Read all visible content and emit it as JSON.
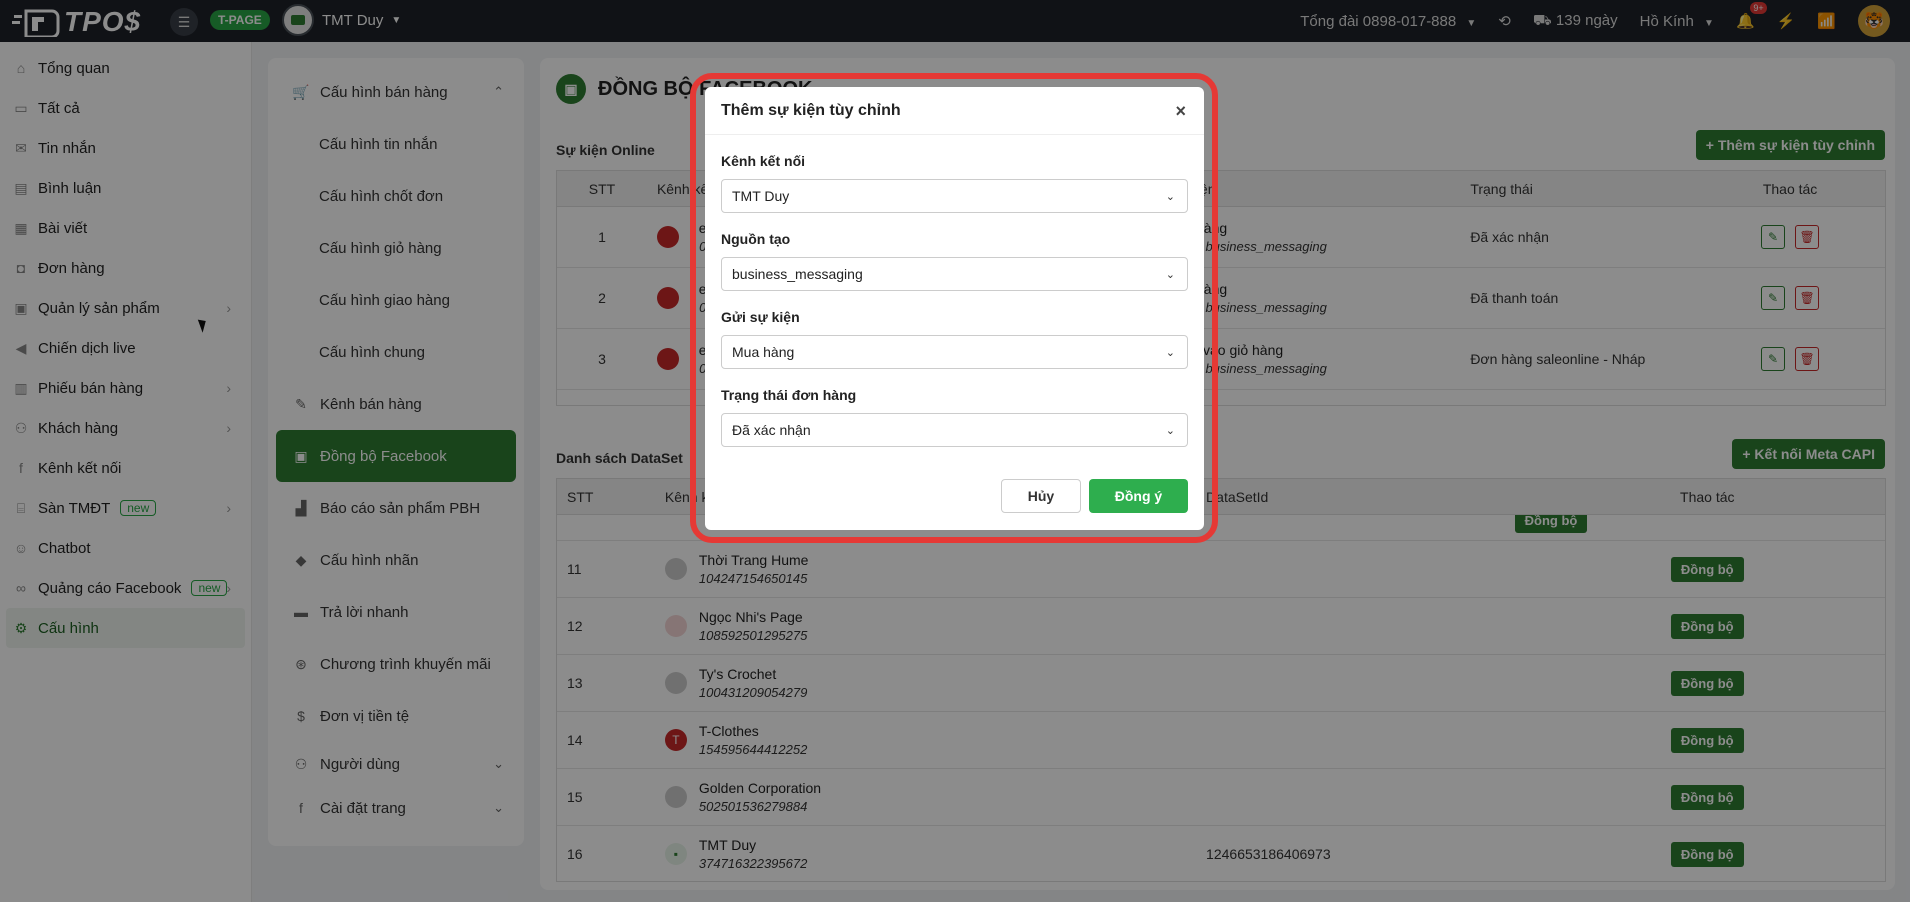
{
  "topbar": {
    "logo_text": "TPO$",
    "tpage_badge": "T-PAGE",
    "current_page": "TMT Duy",
    "hotline_label": "Tổng đài",
    "hotline_number": "0898-017-888",
    "days_left": "139 ngày",
    "user_name": "Hồ Kính",
    "notif_count": "9+"
  },
  "sidebar": {
    "items": [
      {
        "label": "Tổng quan",
        "icon": "home-icon"
      },
      {
        "label": "Tất cả",
        "icon": "inbox-icon"
      },
      {
        "label": "Tin nhắn",
        "icon": "mail-icon"
      },
      {
        "label": "Bình luận",
        "icon": "comment-icon"
      },
      {
        "label": "Bài viết",
        "icon": "post-icon"
      },
      {
        "label": "Đơn hàng",
        "icon": "bag-icon"
      },
      {
        "label": "Quản lý sản phẩm",
        "icon": "product-icon"
      },
      {
        "label": "Chiến dịch live",
        "icon": "megaphone-icon"
      },
      {
        "label": "Phiếu bán hàng",
        "icon": "receipt-icon"
      },
      {
        "label": "Khách hàng",
        "icon": "users-icon"
      },
      {
        "label": "Kênh kết nối",
        "icon": "facebook-icon"
      },
      {
        "label": "Sàn TMĐT",
        "icon": "store-icon",
        "badge": "new"
      },
      {
        "label": "Chatbot",
        "icon": "bot-icon"
      },
      {
        "label": "Quảng cáo Facebook",
        "icon": "meta-icon",
        "badge": "new"
      },
      {
        "label": "Cấu hình",
        "icon": "gear-icon"
      }
    ]
  },
  "settings_menu": {
    "group_title": "Cấu hình bán hàng",
    "sub_items": [
      "Cấu hình tin nhắn",
      "Cấu hình chốt đơn",
      "Cấu hình giỏ hàng",
      "Cấu hình giao hàng",
      "Cấu hình chung"
    ],
    "items": [
      "Kênh bán hàng",
      "Đồng bộ Facebook",
      "Báo cáo sản phẩm PBH",
      "Cấu hình nhãn",
      "Trả lời nhanh",
      "Chương trình khuyến mãi",
      "Đơn vị tiền tệ",
      "Người dùng",
      "Cài đặt trang"
    ]
  },
  "content": {
    "title": "ĐỒNG BỘ FACEBOOK",
    "events_label": "Sự kiện Online",
    "add_event_button": "+ Thêm sự kiện tùy chỉnh",
    "events_table": {
      "headers": [
        "STT",
        "Kênh kế",
        "ự kiện",
        "Trạng thái",
        "Thao tác"
      ],
      "rows": [
        {
          "stt": "1",
          "name": "I e's",
          "id": "• 06",
          "event": "ua hàng",
          "source": "uồn: business_messaging",
          "status": "Đã xác nhận"
        },
        {
          "stt": "2",
          "name": "I e's",
          "id": "• 06",
          "event": "ua hàng",
          "source": "uồn: business_messaging",
          "status": "Đã thanh toán"
        },
        {
          "stt": "3",
          "name": "I e's",
          "id": "• 06",
          "event": "iêm vào giỏ hàng",
          "source": "uồn: business_messaging",
          "status": "Đơn hàng saleonline - Nháp"
        }
      ]
    },
    "dataset_label": "Danh sách DataSet",
    "connect_capi_button": "+ Kết nối Meta CAPI",
    "dataset_table": {
      "headers": [
        "STT",
        "Kênh k",
        "DataSetId",
        "Thao tác"
      ],
      "partial_row_button": "Đồng bộ",
      "rows": [
        {
          "stt": "11",
          "name": "Thời Trang Hume",
          "id": "104247154650145",
          "dataset": "",
          "action": "Đồng bộ"
        },
        {
          "stt": "12",
          "name": "Ngọc Nhi's Page",
          "id": "108592501295275",
          "dataset": "",
          "action": "Đồng bộ"
        },
        {
          "stt": "13",
          "name": "Ty's Crochet",
          "id": "100431209054279",
          "dataset": "",
          "action": "Đồng bộ"
        },
        {
          "stt": "14",
          "name": "T-Clothes",
          "id": "154595644412252",
          "dataset": "",
          "action": "Đồng bộ",
          "avatar_letter": "T"
        },
        {
          "stt": "15",
          "name": "Golden Corporation",
          "id": "502501536279884",
          "dataset": "",
          "action": "Đồng bộ"
        },
        {
          "stt": "16",
          "name": "TMT Duy",
          "id": "374716322395672",
          "dataset": "1246653186406973",
          "action": "Đồng bộ"
        }
      ]
    }
  },
  "modal": {
    "title": "Thêm sự kiện tùy chỉnh",
    "fields": [
      {
        "label": "Kênh kết nối",
        "value": "TMT Duy"
      },
      {
        "label": "Nguồn tạo",
        "value": "business_messaging"
      },
      {
        "label": "Gửi sự kiện",
        "value": "Mua hàng"
      },
      {
        "label": "Trạng thái đơn hàng",
        "value": "Đã xác nhận"
      }
    ],
    "cancel_label": "Hủy",
    "ok_label": "Đồng ý"
  },
  "colors": {
    "brand_green": "#2e7d32",
    "ok_green": "#2eae4e",
    "highlight_red": "#e53935",
    "topbar": "#1e2229"
  }
}
